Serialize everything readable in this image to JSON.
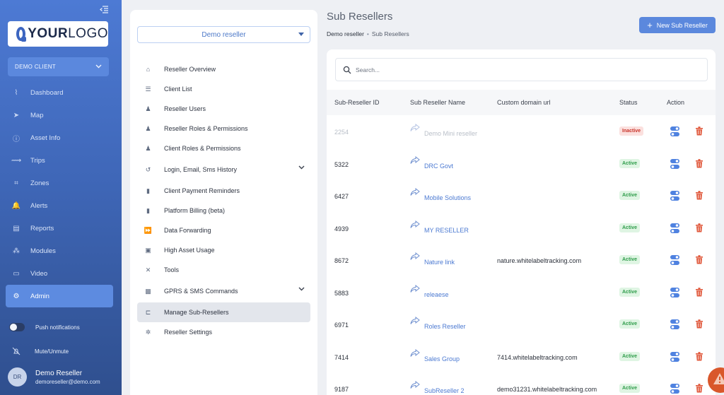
{
  "sidebar": {
    "logo": {
      "bold": "YOUR",
      "light": "LOGO"
    },
    "client_select": "DEMO CLIENT",
    "items": [
      {
        "label": "Dashboard",
        "icon": "dashboard-icon",
        "glyph": "⌇"
      },
      {
        "label": "Map",
        "icon": "map-icon",
        "glyph": "➤"
      },
      {
        "label": "Asset Info",
        "icon": "info-icon",
        "glyph": "ⓘ"
      },
      {
        "label": "Trips",
        "icon": "trips-icon",
        "glyph": "⟿"
      },
      {
        "label": "Zones",
        "icon": "zones-icon",
        "glyph": "⌗"
      },
      {
        "label": "Alerts",
        "icon": "bell-icon",
        "glyph": "🔔"
      },
      {
        "label": "Reports",
        "icon": "report-icon",
        "glyph": "▤"
      },
      {
        "label": "Modules",
        "icon": "modules-icon",
        "glyph": "⁂"
      },
      {
        "label": "Video",
        "icon": "video-icon",
        "glyph": "▭"
      },
      {
        "label": "Admin",
        "icon": "gear-icon",
        "glyph": "⚙",
        "active": true
      }
    ],
    "push_label": "Push notifications",
    "mute_label": "Mute/Unmute",
    "user": {
      "initials": "DR",
      "name": "Demo Reseller",
      "email": "demoreseller@demo.com"
    }
  },
  "admin_menu": {
    "reseller_select": "Demo reseller",
    "items": [
      {
        "label": "Reseller Overview",
        "icon": "home-icon",
        "glyph": "⌂"
      },
      {
        "label": "Client List",
        "icon": "list-icon",
        "glyph": "☰"
      },
      {
        "label": "Reseller Users",
        "icon": "user-icon",
        "glyph": "♟"
      },
      {
        "label": "Reseller Roles & Permissions",
        "icon": "user-lock-icon",
        "glyph": "♟"
      },
      {
        "label": "Client Roles & Permissions",
        "icon": "user-check-icon",
        "glyph": "♟"
      },
      {
        "label": "Login, Email, Sms History",
        "icon": "history-icon",
        "glyph": "↺",
        "expandable": true
      },
      {
        "label": "Client Payment Reminders",
        "icon": "document-icon",
        "glyph": "▮"
      },
      {
        "label": "Platform Billing (beta)",
        "icon": "billing-icon",
        "glyph": "▮"
      },
      {
        "label": "Data Forwarding",
        "icon": "forward-icon",
        "glyph": "⏩"
      },
      {
        "label": "High Asset Usage",
        "icon": "usage-icon",
        "glyph": "▣"
      },
      {
        "label": "Tools",
        "icon": "tools-icon",
        "glyph": "✕"
      },
      {
        "label": "GPRS & SMS Commands",
        "icon": "terminal-icon",
        "glyph": "▩",
        "expandable": true
      },
      {
        "label": "Manage Sub-Resellers",
        "icon": "sub-reseller-icon",
        "glyph": "⊏",
        "active": true
      },
      {
        "label": "Reseller Settings",
        "icon": "settings-icon",
        "glyph": "✲"
      }
    ]
  },
  "main": {
    "title": "Sub Resellers",
    "breadcrumb": {
      "root": "Demo reseller",
      "current": "Sub Resellers"
    },
    "new_button": "New Sub Reseller",
    "search_placeholder": "Search...",
    "columns": [
      "Sub-Reseller ID",
      "Sub Reseller Name",
      "Custom domain url",
      "Status",
      "Action"
    ],
    "rows": [
      {
        "id": "2254",
        "name": "Demo Mini reseller",
        "url": "",
        "status": "Inactive"
      },
      {
        "id": "5322",
        "name": "DRC Govt",
        "url": "",
        "status": "Active"
      },
      {
        "id": "6427",
        "name": "Mobile Solutions",
        "url": "",
        "status": "Active"
      },
      {
        "id": "4939",
        "name": "MY RESELLER",
        "url": "",
        "status": "Active"
      },
      {
        "id": "8672",
        "name": "Nature link",
        "url": "nature.whitelabeltracking.com",
        "status": "Active"
      },
      {
        "id": "5883",
        "name": "releaese",
        "url": "",
        "status": "Active"
      },
      {
        "id": "6971",
        "name": "Roles Reseller",
        "url": "",
        "status": "Active"
      },
      {
        "id": "7414",
        "name": "Sales Group",
        "url": "7414.whitelabeltracking.com",
        "status": "Active"
      },
      {
        "id": "9187",
        "name": "SubReseller 2",
        "url": "demo31231.whitelabeltracking.com",
        "status": "Active"
      }
    ]
  },
  "colors": {
    "accent": "#5b88dd",
    "active_status": "#2e9c4a",
    "inactive_status": "#c9342a",
    "delete": "#e0573a",
    "alert_fab": "#d9572b"
  }
}
